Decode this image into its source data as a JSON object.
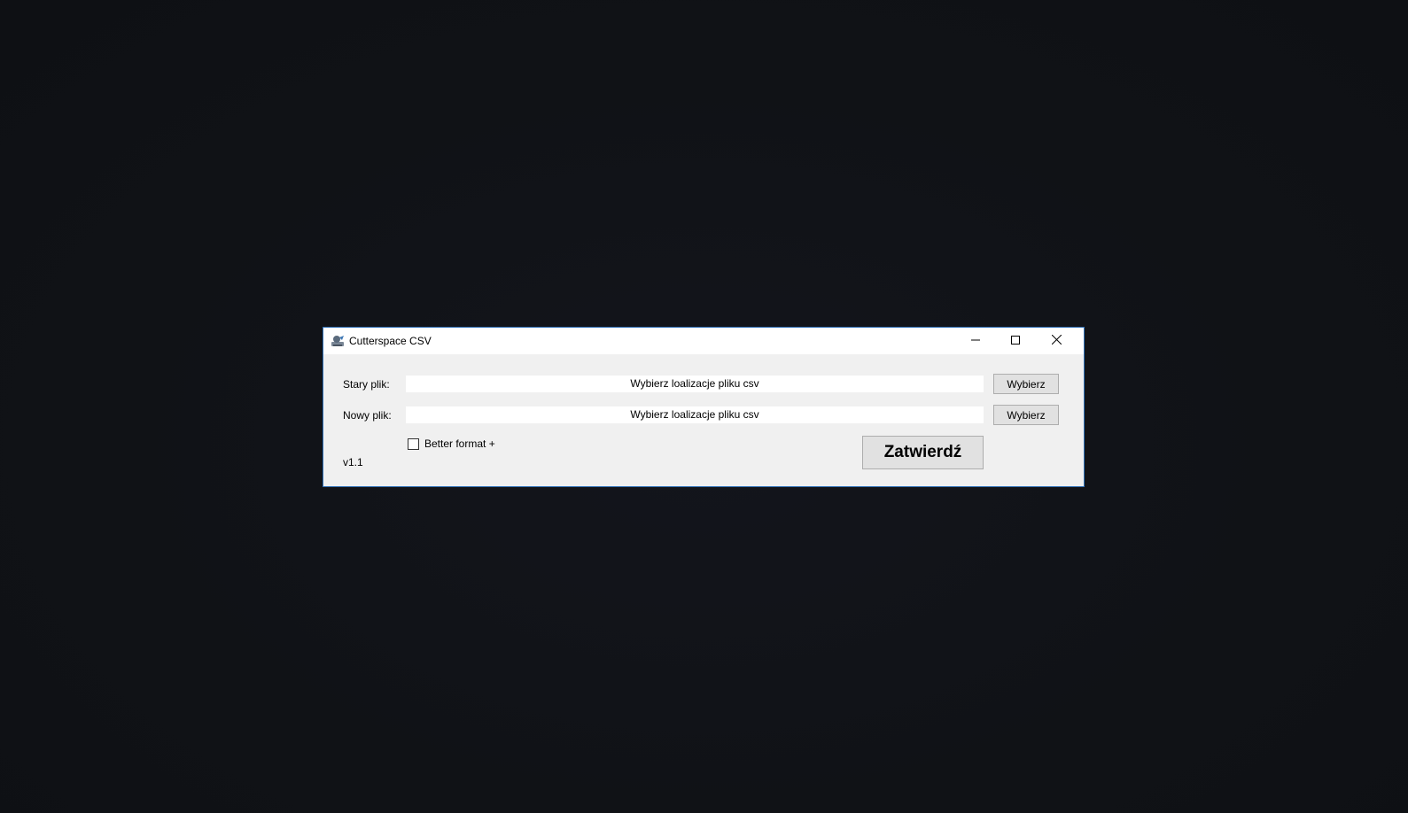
{
  "window": {
    "title": "Cutterspace CSV",
    "icon": "app-icon"
  },
  "controls": {
    "minimize_icon": "minimize-icon",
    "maximize_icon": "maximize-icon",
    "close_icon": "close-icon"
  },
  "form": {
    "old_file": {
      "label": "Stary plik:",
      "value": "Wybierz loalizacje pliku csv",
      "button_label": "Wybierz"
    },
    "new_file": {
      "label": "Nowy plik:",
      "value": "Wybierz loalizacje pliku csv",
      "button_label": "Wybierz"
    },
    "checkbox": {
      "label": "Better format +",
      "checked": false
    },
    "submit_label": "Zatwierdź",
    "version": "v1.1"
  },
  "colors": {
    "desktop_bg": "#111318",
    "window_bg": "#f0f0f0",
    "window_border": "#2f6fb5",
    "checkbox_border": "#333333"
  }
}
